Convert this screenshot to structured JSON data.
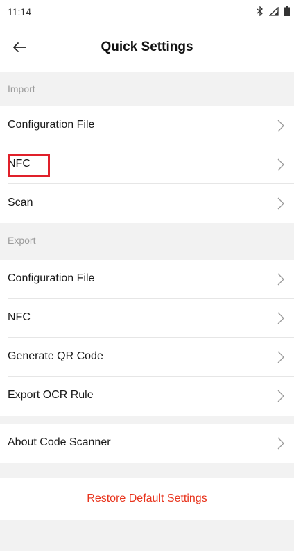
{
  "status_bar": {
    "time": "11:14",
    "icons": [
      "bluetooth-icon",
      "signal-icon",
      "battery-icon"
    ]
  },
  "header": {
    "title": "Quick Settings",
    "back_icon": "back-arrow-icon"
  },
  "sections": {
    "import": {
      "title": "Import",
      "items": [
        "Configuration File",
        "NFC",
        "Scan"
      ]
    },
    "export": {
      "title": "Export",
      "items": [
        "Configuration File",
        "NFC",
        "Generate QR Code",
        "Export OCR Rule"
      ]
    },
    "about": {
      "items": [
        "About Code Scanner"
      ]
    }
  },
  "restore_label": "Restore Default Settings",
  "colors": {
    "accent_red": "#e8331c",
    "highlight": "#e0202a",
    "background": "#f2f2f2"
  }
}
